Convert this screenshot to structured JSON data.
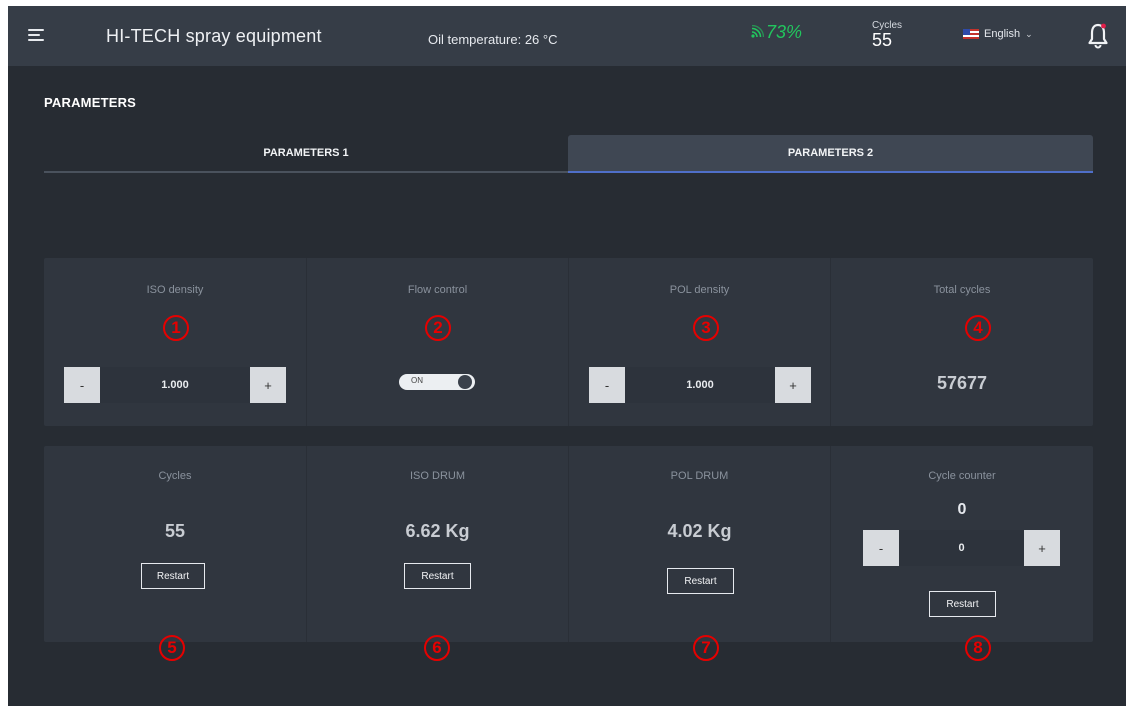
{
  "topbar": {
    "app_title": "HI-TECH spray equipment",
    "oil_temperature": "Oil temperature: 26 °C",
    "signal_percent": "73%",
    "cycles_label": "Cycles",
    "cycles_value": "55",
    "language": "English",
    "colors": {
      "signal": "#22c55e",
      "bar": "#363d47",
      "background": "#272c33"
    }
  },
  "page": {
    "title": "PARAMETERS",
    "tabs": [
      {
        "label": "PARAMETERS 1",
        "active": false
      },
      {
        "label": "PARAMETERS 2",
        "active": true
      }
    ]
  },
  "panel1": {
    "iso_density": {
      "label": "ISO density",
      "marker": "1",
      "minus": "-",
      "value": "1.000",
      "plus": "+"
    },
    "flow_control": {
      "label": "Flow control",
      "marker": "2",
      "toggle_text": "ON",
      "on": true
    },
    "pol_density": {
      "label": "POL density",
      "marker": "3",
      "minus": "-",
      "value": "1.000",
      "plus": "+"
    },
    "total_cycles": {
      "label": "Total cycles",
      "marker": "4",
      "value": "57677"
    }
  },
  "panel2": {
    "cycles": {
      "label": "Cycles",
      "value": "55",
      "restart": "Restart",
      "marker": "5"
    },
    "iso_drum": {
      "label": "ISO DRUM",
      "value": "6.62 Kg",
      "restart": "Restart",
      "marker": "6"
    },
    "pol_drum": {
      "label": "POL DRUM",
      "value": "4.02 Kg",
      "restart": "Restart",
      "marker": "7"
    },
    "cycle_counter": {
      "label": "Cycle counter",
      "value": "0",
      "minus": "-",
      "input": "0",
      "plus": "+",
      "restart": "Restart",
      "marker": "8"
    }
  },
  "icons": [
    "menu-icon",
    "signal-icon",
    "us-flag-icon",
    "chevron-down-icon",
    "bell-icon"
  ],
  "marker_color": "#e60000"
}
